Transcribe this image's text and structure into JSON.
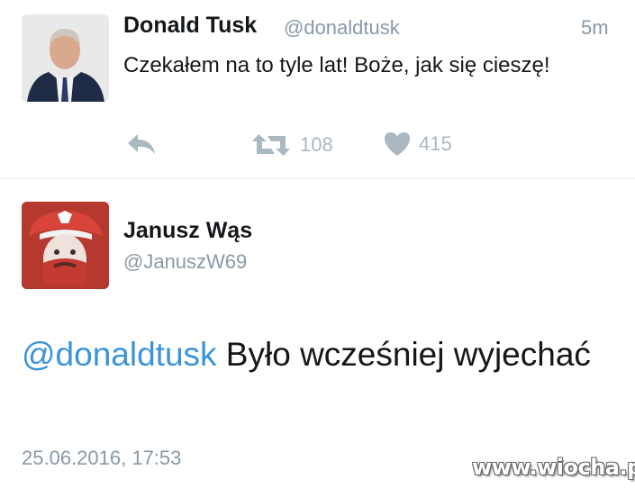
{
  "tweet1": {
    "author_name": "Donald Tusk",
    "author_handle": "@donaldtusk",
    "time_ago": "5m",
    "text": "Czekałem na to tyle lat! Boże, jak się cieszę!",
    "actions": {
      "reply_icon": "reply-icon",
      "retweet_icon": "retweet-icon",
      "retweet_count": "108",
      "like_icon": "heart-icon",
      "like_count": "415"
    }
  },
  "tweet2": {
    "author_name": "Janusz Wąs",
    "author_handle": "@JanuszW69",
    "mention": "@donaldtusk",
    "text": " Było wcześniej wyjechać",
    "timestamp": "25.06.2016, 17:53"
  },
  "watermark": "www.wiocha.pl",
  "colors": {
    "link": "#3b94d9",
    "muted": "#8899a6",
    "action": "#aab8c2",
    "divider": "#e1e8ed"
  }
}
